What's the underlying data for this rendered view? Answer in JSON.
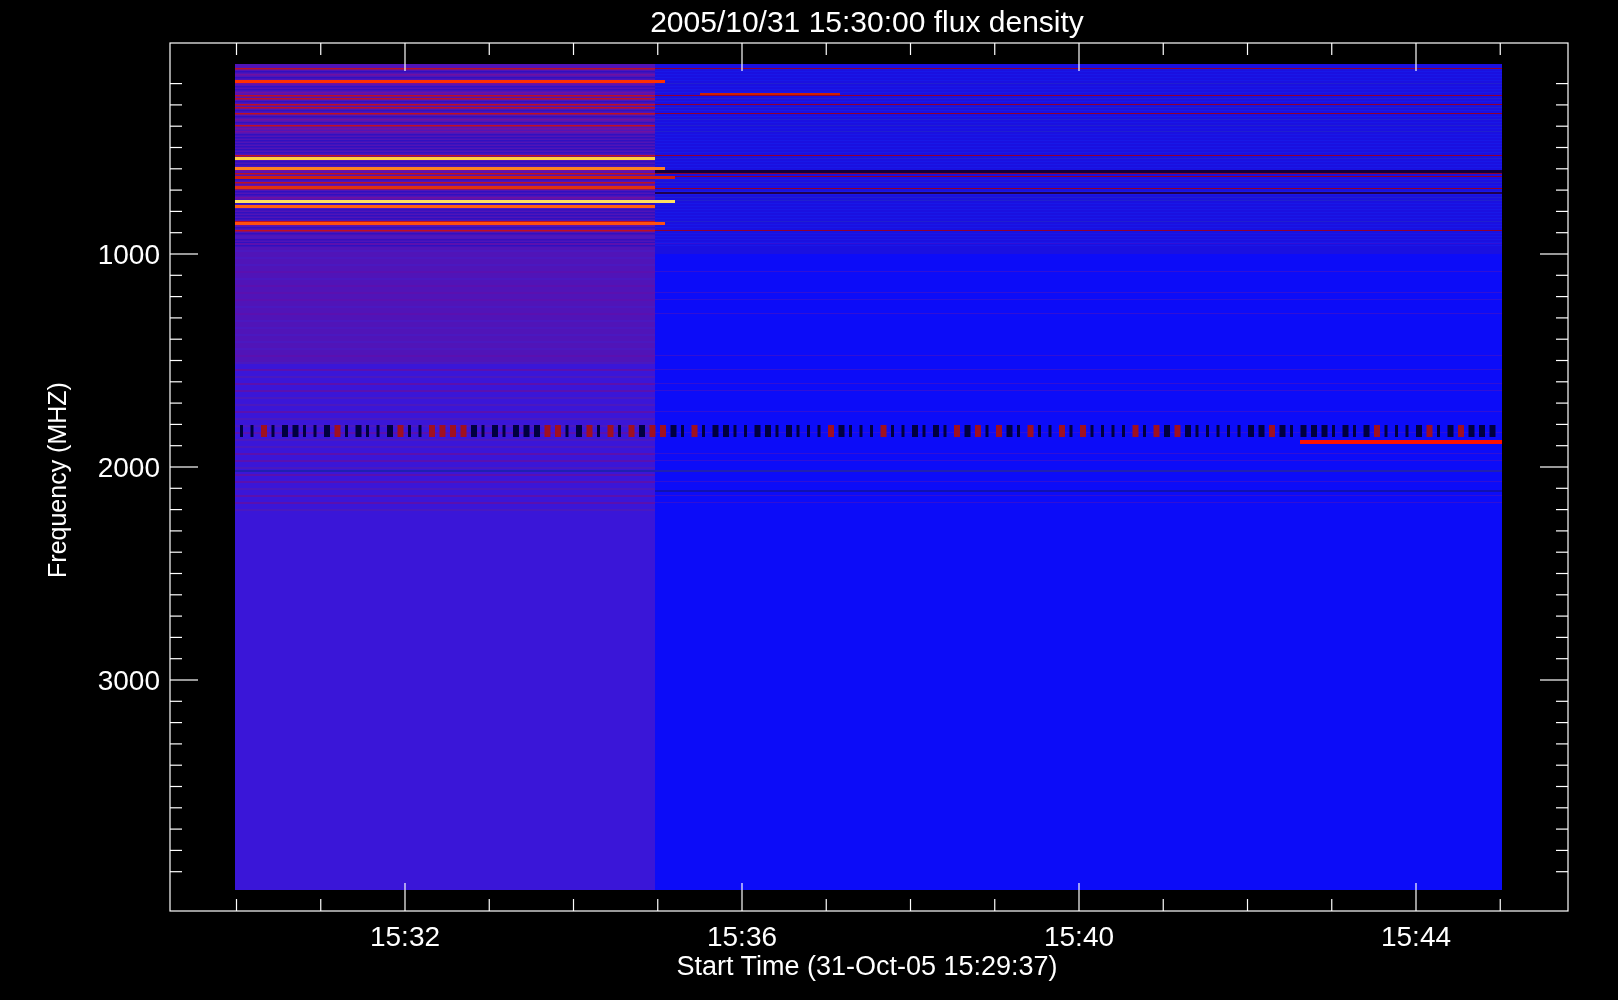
{
  "title": "2005/10/31 15:30:00 flux density",
  "y_axis": {
    "label": "Frequency (MHZ)",
    "tick_labels": [
      "1000",
      "2000",
      "3000"
    ]
  },
  "x_axis": {
    "label": "Start Time (31-Oct-05 15:29:37)",
    "tick_labels": [
      "15:32",
      "15:36",
      "15:40",
      "15:44"
    ]
  }
}
